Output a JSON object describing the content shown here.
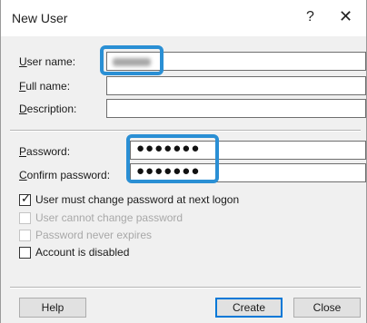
{
  "window": {
    "title": "New User",
    "help_glyph": "?",
    "close_glyph": "✕"
  },
  "labels": {
    "user_name": "User name:",
    "full_name": "Full name:",
    "description": "Description:",
    "password": "Password:",
    "confirm_password": "Confirm password:"
  },
  "fields": {
    "user_name": "",
    "full_name": "",
    "description": "",
    "password": "●●●●●●●",
    "confirm_password": "●●●●●●●"
  },
  "checkboxes": [
    {
      "label": "User must change password at next logon",
      "checked": true,
      "enabled": true
    },
    {
      "label": "User cannot change password",
      "checked": false,
      "enabled": false
    },
    {
      "label": "Password never expires",
      "checked": false,
      "enabled": false
    },
    {
      "label": "Account is disabled",
      "checked": false,
      "enabled": true
    }
  ],
  "buttons": {
    "help": "Help",
    "create": "Create",
    "close": "Close"
  },
  "colors": {
    "highlight": "#2a8fd4",
    "default_button_border": "#0078d7"
  }
}
